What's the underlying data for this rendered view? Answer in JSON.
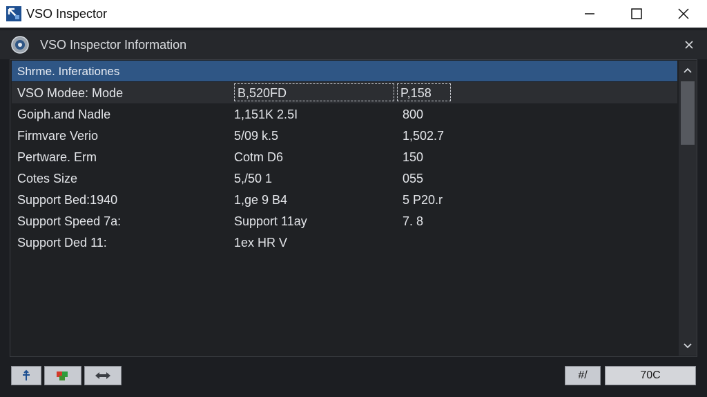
{
  "window": {
    "title": "VSO Inspector"
  },
  "panel": {
    "title": "VSO Inspector Information"
  },
  "list": {
    "header": "Shrme. Inferationes",
    "rows": [
      {
        "label": "VSO Modee: Mode",
        "value": "B,520FD",
        "extra": "P,158"
      },
      {
        "label": "Goiph.and Nadle",
        "value": "1,151K 2.5I",
        "extra": "800"
      },
      {
        "label": "Firmvare Verio",
        "value": "5/09 k.5",
        "extra": "1,502.7"
      },
      {
        "label": "Pertware. Erm",
        "value": "Cotm D6",
        "extra": "150"
      },
      {
        "label": "Cotes Size",
        "value": "5,/50 1",
        "extra": "055"
      },
      {
        "label": "Support Bed:1940",
        "value": "1,ge 9 B4",
        "extra": "5 P20.r"
      },
      {
        "label": "Support Speed 7a:",
        "value": "Support 11ay",
        "extra": "7. 8"
      },
      {
        "label": "Support Ded 11:",
        "value": "1ex HR V",
        "extra": ""
      }
    ]
  },
  "footer": {
    "mid_button": "#/",
    "right_button": "70C"
  },
  "colors": {
    "accent": "#2f5685",
    "titlebar": "#ffffff",
    "background": "#1c1e22"
  },
  "icons": {
    "app": "app-logo-icon",
    "panel": "info-disc-icon",
    "b1": "pin-icon",
    "b2": "puzzle-icon",
    "b3": "swap-arrows-icon"
  }
}
